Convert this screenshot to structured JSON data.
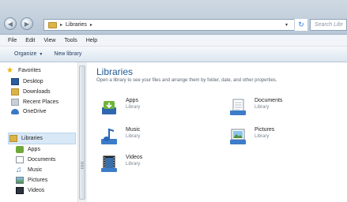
{
  "address": {
    "crumbs": [
      "Libraries"
    ],
    "separator": "▸",
    "dropdown": "▾",
    "refresh_icon": "refresh-icon",
    "search_placeholder": "Search Libr"
  },
  "menubar": [
    "File",
    "Edit",
    "View",
    "Tools",
    "Help"
  ],
  "toolbar": {
    "organize": "Organize",
    "organize_caret": "▼",
    "new_library": "New library"
  },
  "nav": {
    "favorites_header": "Favorites",
    "favorites": [
      "Desktop",
      "Downloads",
      "Recent Places",
      "OneDrive"
    ],
    "libraries_header": "Libraries",
    "libraries": [
      "Apps",
      "Documents",
      "Music",
      "Pictures",
      "Videos"
    ]
  },
  "main": {
    "title": "Libraries",
    "subtitle": "Open a library to see your files and arrange them by folder, date, and other properties.",
    "items": [
      {
        "name": "Apps",
        "type": "Library",
        "icon": "apps-library-icon"
      },
      {
        "name": "Documents",
        "type": "Library",
        "icon": "documents-library-icon"
      },
      {
        "name": "Music",
        "type": "Library",
        "icon": "music-library-icon"
      },
      {
        "name": "Pictures",
        "type": "Library",
        "icon": "pictures-library-icon"
      },
      {
        "name": "Videos",
        "type": "Library",
        "icon": "videos-library-icon"
      }
    ]
  },
  "colors": {
    "accent": "#1e5a96",
    "selection": "#d9e8f6"
  }
}
